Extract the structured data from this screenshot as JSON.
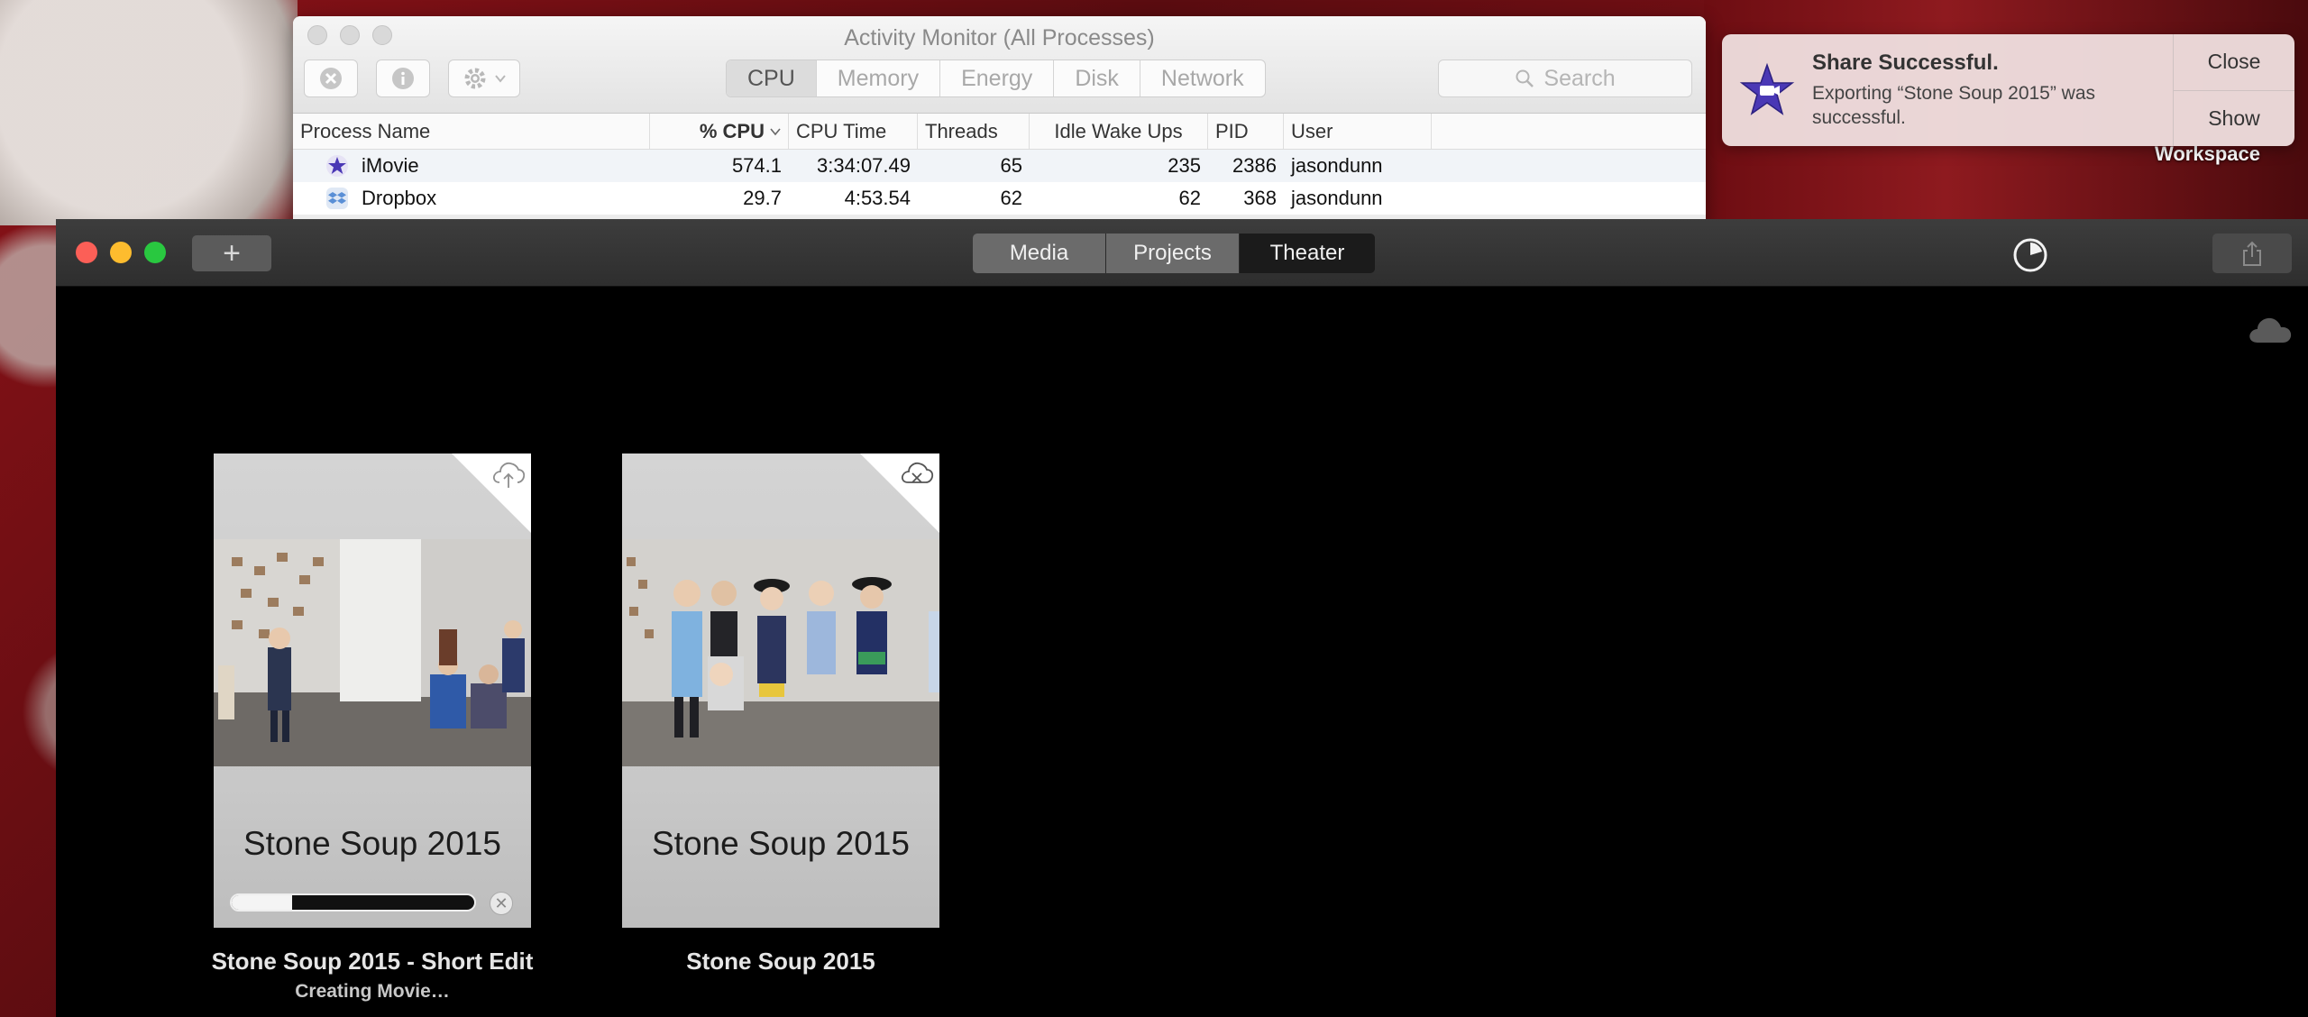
{
  "desktop": {
    "workspace_label": "Workspace"
  },
  "activity_monitor": {
    "title": "Activity Monitor (All Processes)",
    "tabs": [
      "CPU",
      "Memory",
      "Energy",
      "Disk",
      "Network"
    ],
    "active_tab": "CPU",
    "search_placeholder": "Search",
    "columns": [
      "Process Name",
      "% CPU",
      "CPU Time",
      "Threads",
      "Idle Wake Ups",
      "PID",
      "User"
    ],
    "rows": [
      {
        "name": "iMovie",
        "icon": "imovie-star-icon",
        "cpu": "574.1",
        "cpu_time": "3:34:07.49",
        "threads": "65",
        "idle_wake_ups": "235",
        "pid": "2386",
        "user": "jasondunn"
      },
      {
        "name": "Dropbox",
        "icon": "dropbox-icon",
        "cpu": "29.7",
        "cpu_time": "4:53.54",
        "threads": "62",
        "idle_wake_ups": "62",
        "pid": "368",
        "user": "jasondunn"
      }
    ]
  },
  "notification": {
    "title": "Share Successful.",
    "body": "Exporting “Stone Soup 2015” was successful.",
    "close_label": "Close",
    "show_label": "Show",
    "icon": "imovie-star-icon"
  },
  "imovie": {
    "add_label": "+",
    "segments": [
      "Media",
      "Projects",
      "Theater"
    ],
    "active_segment": "Theater",
    "cards": [
      {
        "thumb_title": "Stone Soup 2015",
        "label": "Stone Soup 2015 - Short Edit",
        "status": "Creating Movie…",
        "corner_icon": "cloud-upload-icon",
        "progress": 0.25
      },
      {
        "thumb_title": "Stone Soup 2015",
        "label": "Stone Soup 2015",
        "status": "",
        "corner_icon": "cloud-error-icon",
        "progress": null
      }
    ]
  },
  "colors": {
    "theater_active": "#1b1b1b",
    "segment_inactive": "#6b6b6b",
    "notification_bg": "#eedede",
    "imovie_star": "#4a38b5"
  }
}
